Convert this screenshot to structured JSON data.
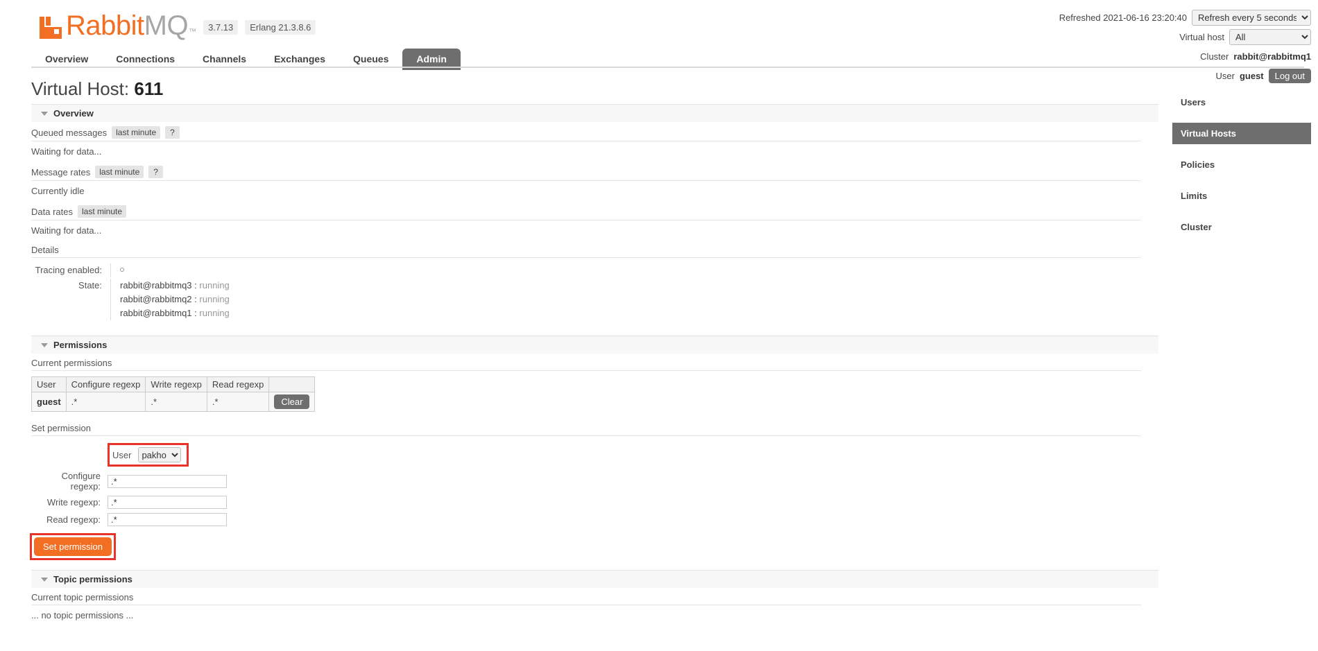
{
  "header": {
    "logo_rabbit": "Rabbit",
    "logo_mq": "MQ",
    "logo_tm": "™",
    "version": "3.7.13",
    "erlang": "Erlang 21.3.8.6",
    "refreshed_label": "Refreshed 2021-06-16 23:20:40",
    "refresh_option": "Refresh every 5 seconds",
    "vhost_label": "Virtual host",
    "vhost_option": "All",
    "cluster_label": "Cluster",
    "cluster_name": "rabbit@rabbitmq1",
    "user_label": "User",
    "user_name": "guest",
    "logout_label": "Log out"
  },
  "tabs": [
    {
      "label": "Overview",
      "active": false
    },
    {
      "label": "Connections",
      "active": false
    },
    {
      "label": "Channels",
      "active": false
    },
    {
      "label": "Exchanges",
      "active": false
    },
    {
      "label": "Queues",
      "active": false
    },
    {
      "label": "Admin",
      "active": true
    }
  ],
  "page": {
    "title_prefix": "Virtual Host:",
    "title_value": "611"
  },
  "overview": {
    "section_label": "Overview",
    "queued_messages_label": "Queued messages",
    "queued_messages_chip": "last minute",
    "queued_messages_help": "?",
    "queued_messages_status": "Waiting for data...",
    "message_rates_label": "Message rates",
    "message_rates_chip": "last minute",
    "message_rates_help": "?",
    "message_rates_status": "Currently idle",
    "data_rates_label": "Data rates",
    "data_rates_chip": "last minute",
    "data_rates_status": "Waiting for data...",
    "details_label": "Details",
    "tracing_label": "Tracing enabled:",
    "tracing_value": "○",
    "state_label": "State:",
    "nodes": [
      {
        "name": "rabbit@rabbitmq3",
        "sep": ":",
        "state": "running"
      },
      {
        "name": "rabbit@rabbitmq2",
        "sep": ":",
        "state": "running"
      },
      {
        "name": "rabbit@rabbitmq1",
        "sep": ":",
        "state": "running"
      }
    ]
  },
  "permissions": {
    "section_label": "Permissions",
    "current_label": "Current permissions",
    "columns": [
      "User",
      "Configure regexp",
      "Write regexp",
      "Read regexp",
      ""
    ],
    "rows": [
      {
        "user": "guest",
        "configure": ".*",
        "write": ".*",
        "read": ".*",
        "action": "Clear"
      }
    ],
    "set_label": "Set permission",
    "user_field_label": "User",
    "user_field_value": "pakho",
    "configure_label": "Configure regexp:",
    "configure_value": ".*",
    "write_label": "Write regexp:",
    "write_value": ".*",
    "read_label": "Read regexp:",
    "read_value": ".*",
    "submit_label": "Set permission"
  },
  "topic_permissions": {
    "section_label": "Topic permissions",
    "current_label": "Current topic permissions",
    "empty_text": "... no topic permissions ..."
  },
  "rightnav": [
    {
      "label": "Users",
      "active": false
    },
    {
      "label": "Virtual Hosts",
      "active": true
    },
    {
      "label": "Policies",
      "active": false
    },
    {
      "label": "Limits",
      "active": false
    },
    {
      "label": "Cluster",
      "active": false
    }
  ],
  "colors": {
    "brand_orange": "#f26e22",
    "active_gray": "#6e6e6e",
    "highlight_red": "#e8322a"
  }
}
